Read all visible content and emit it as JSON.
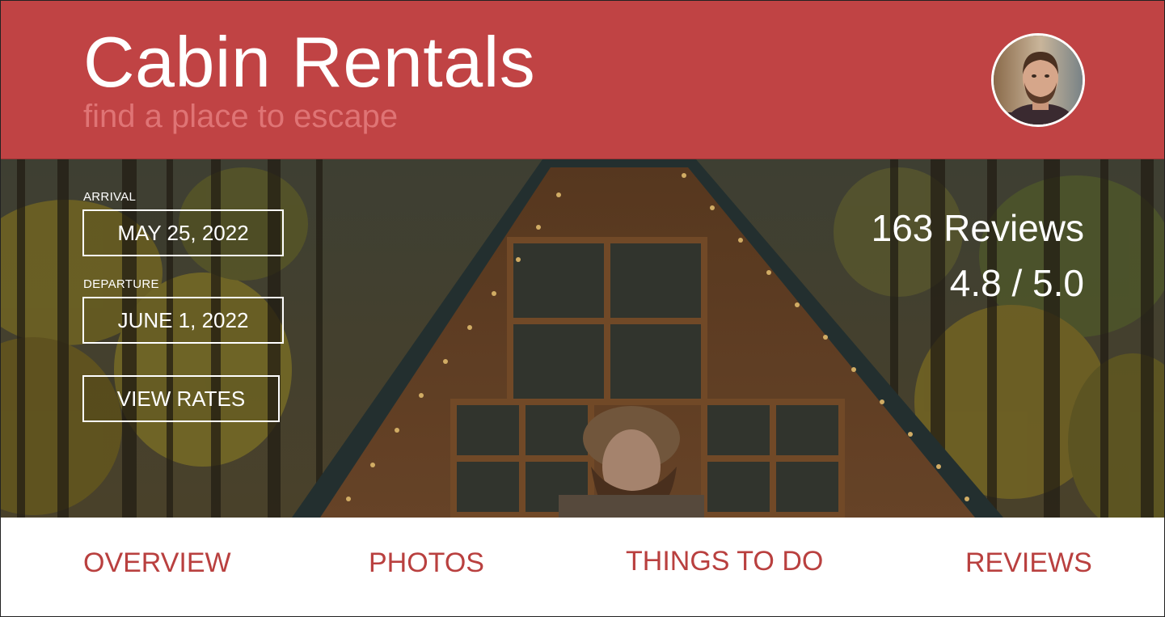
{
  "header": {
    "title": "Cabin Rentals",
    "subtitle": "find a place to escape",
    "background_color": "#c04344",
    "subtitle_color": "#df7475"
  },
  "booking": {
    "arrival_label": "ARRIVAL",
    "arrival_value": "MAY 25, 2022",
    "departure_label": "DEPARTURE",
    "departure_value": "JUNE 1, 2022",
    "view_rates_label": "VIEW RATES"
  },
  "stats": {
    "reviews": "163 Reviews",
    "rating": "4.8 / 5.0"
  },
  "nav": {
    "items": [
      {
        "label": "OVERVIEW"
      },
      {
        "label": "PHOTOS"
      },
      {
        "label": "THINGS TO DO"
      },
      {
        "label": "REVIEWS"
      }
    ],
    "color": "#b9403f"
  },
  "icons": {
    "avatar": "user-avatar"
  }
}
